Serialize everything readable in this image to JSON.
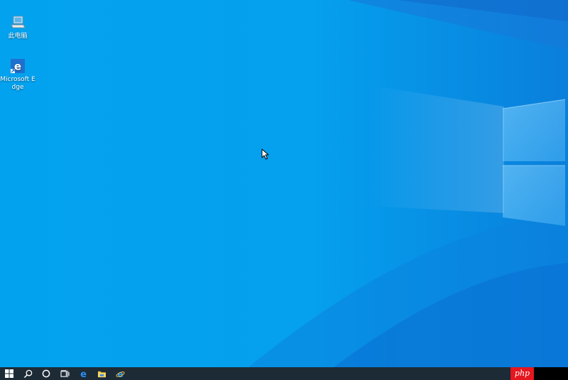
{
  "desktop": {
    "background_color": "#03a1ee",
    "icons": [
      {
        "label": "此电脑",
        "icon": "computer-icon"
      },
      {
        "label": "Microsoft Edge",
        "icon": "edge-icon"
      }
    ]
  },
  "taskbar": {
    "background_color": "#1c2b36",
    "buttons": [
      {
        "icon": "windows-start-icon"
      },
      {
        "icon": "search-icon"
      },
      {
        "icon": "cortana-circle-icon"
      },
      {
        "icon": "task-view-icon"
      },
      {
        "icon": "edge-icon"
      },
      {
        "icon": "file-explorer-icon"
      },
      {
        "icon": "internet-explorer-icon"
      }
    ],
    "watermark": "php"
  }
}
